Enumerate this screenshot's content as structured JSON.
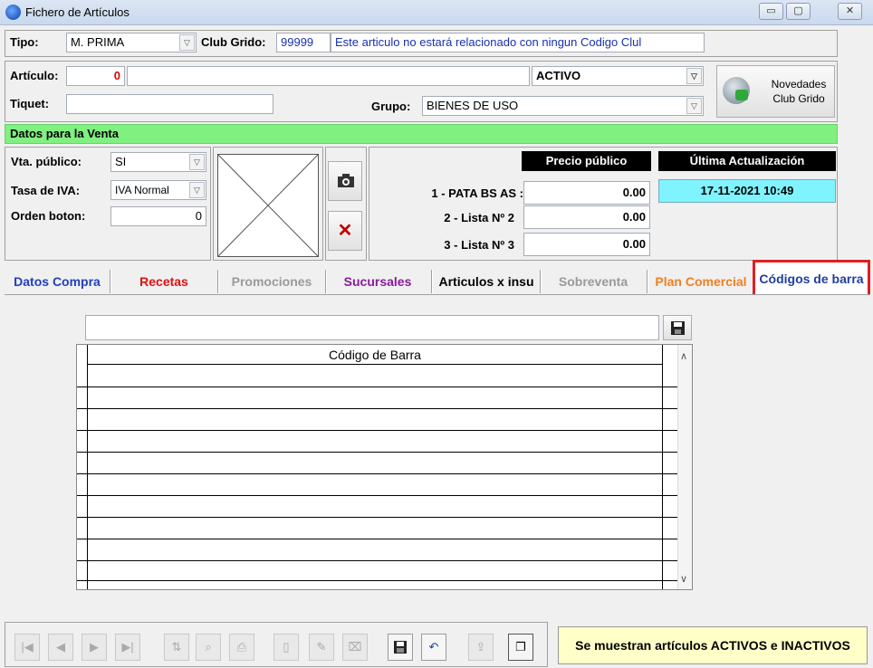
{
  "window": {
    "title": "Fichero de Artículos",
    "buttons": [
      "▭",
      "▢",
      "✕"
    ]
  },
  "header": {
    "tipo_label": "Tipo:",
    "tipo_value": "M. PRIMA",
    "club_label": "Club Grido:",
    "club_code": "99999",
    "club_message": "Este articulo no estará relacionado con ningun Codigo Clul"
  },
  "articulo": {
    "articulo_label": "Artículo:",
    "articulo_value": "0",
    "articulo_desc": "",
    "estado_value": "ACTIVO",
    "tiquet_label": "Tiquet:",
    "tiquet_value": "",
    "grupo_label": "Grupo:",
    "grupo_value": "BIENES DE USO",
    "novedades_label_1": "Novedades",
    "novedades_label_2": "Club Grido"
  },
  "venta": {
    "section_title": "Datos para la Venta",
    "vta_publico_label": "Vta. público:",
    "vta_publico_value": "SI",
    "tasa_iva_label": "Tasa de IVA:",
    "tasa_iva_value": "IVA Normal",
    "orden_boton_label": "Orden boton:",
    "orden_boton_value": "0",
    "precio_header": "Precio público",
    "actualizacion_header": "Última Actualización",
    "actualizacion_value": "17-11-2021 10:49",
    "listas": [
      {
        "label": "1 - PATA BS AS :",
        "value": "0.00"
      },
      {
        "label": "2 - Lista Nº 2",
        "value": "0.00"
      },
      {
        "label": "3 - Lista Nº 3",
        "value": "0.00"
      }
    ]
  },
  "tabs": [
    {
      "label": "Datos Compra",
      "color": "#1f3fbf"
    },
    {
      "label": "Recetas",
      "color": "#e01010"
    },
    {
      "label": "Promociones",
      "color": "#9a9a9a"
    },
    {
      "label": "Sucursales",
      "color": "#8a1a9a"
    },
    {
      "label": "Articulos x insu",
      "color": "#000000"
    },
    {
      "label": "Sobreventa",
      "color": "#9a9a9a"
    },
    {
      "label": "Plan Comercial",
      "color": "#f08020"
    },
    {
      "label": "Códigos de barra",
      "color": "#1f3f9f"
    }
  ],
  "barcodes": {
    "input_value": "",
    "column_header": "Código de Barra",
    "rows": 10
  },
  "footer": {
    "status_text": "Se muestran artículos ACTIVOS e INACTIVOS",
    "status_bg": "#ffffc8"
  }
}
